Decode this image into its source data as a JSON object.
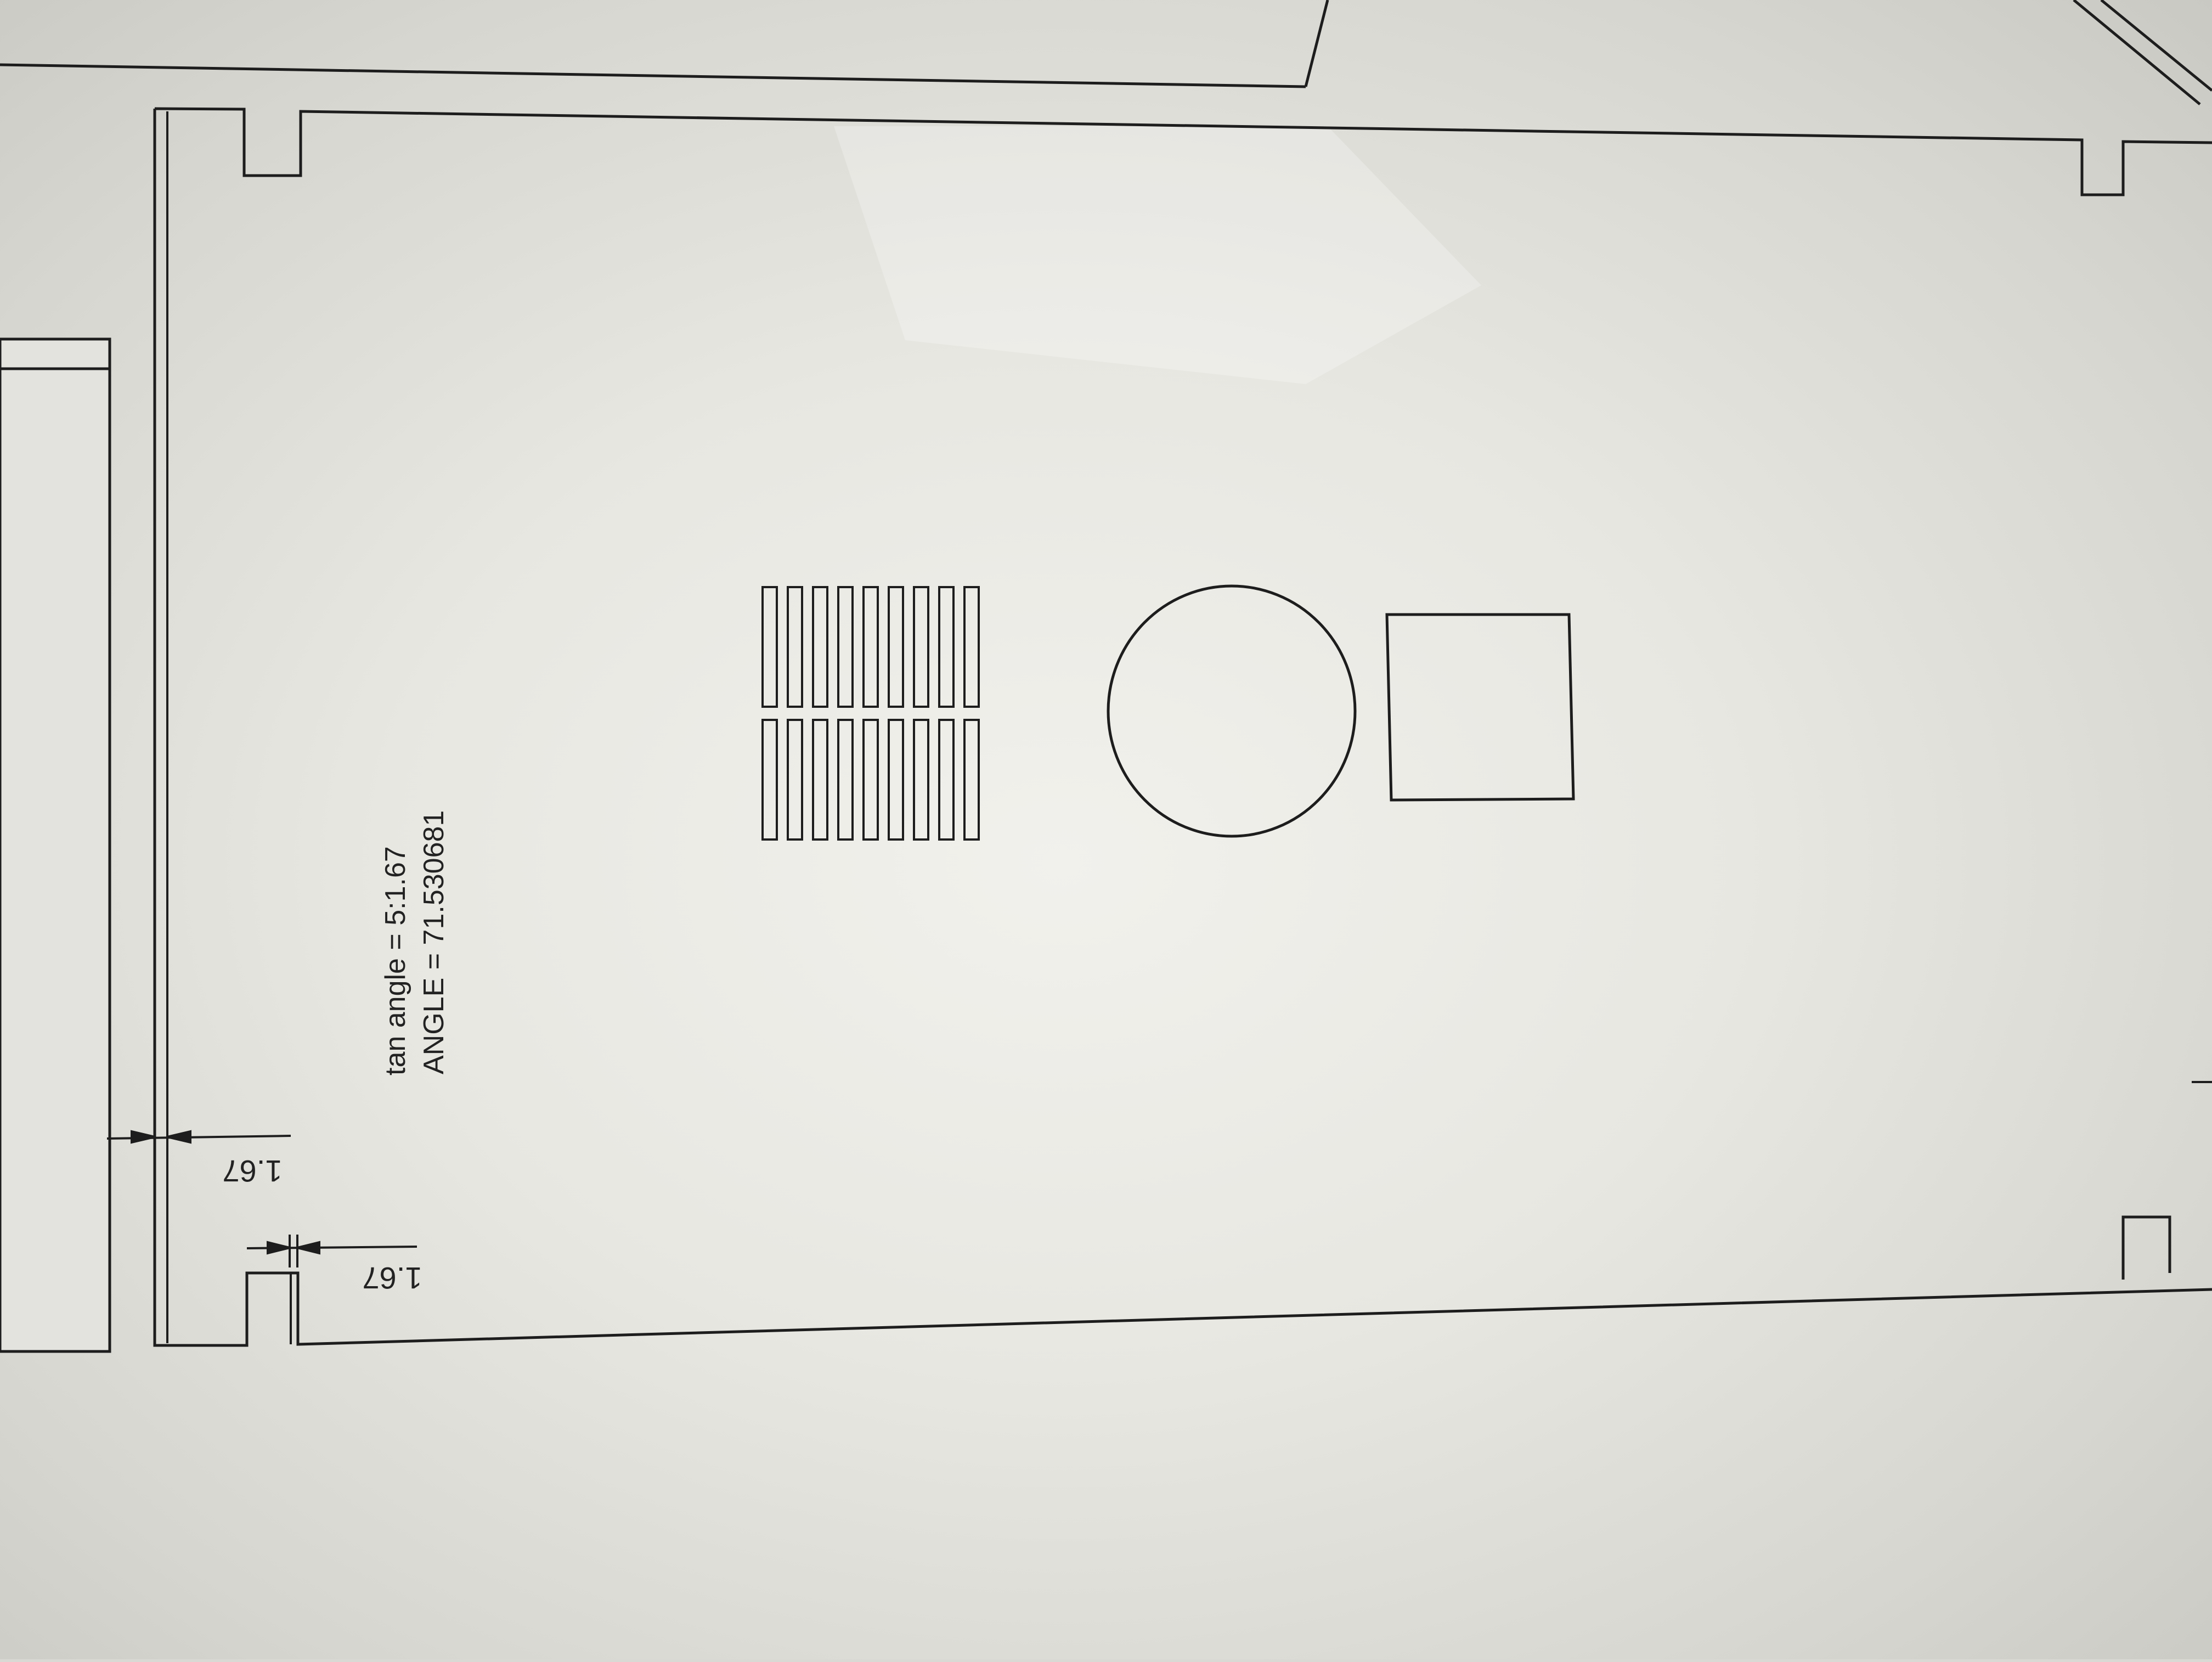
{
  "drawing": {
    "note_line_1": "tan angle = 5:1.67",
    "note_line_2": "ANGLE = 71.530681",
    "dim_1": "1.67",
    "dim_2": "1.67",
    "slot_rows": 2,
    "slot_columns": 9
  },
  "colors": {
    "line": "#1d1d1d",
    "paper": "#eeeee8",
    "background": "#d6d6d0"
  }
}
